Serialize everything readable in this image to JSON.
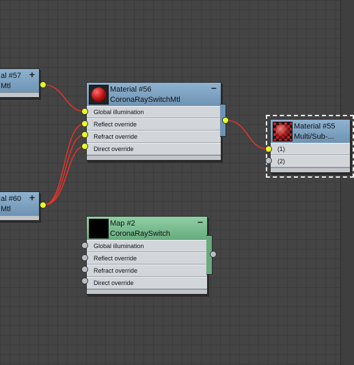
{
  "nodes": {
    "mat57": {
      "title": "al #57",
      "sub": "Mtl",
      "toggle": "+"
    },
    "mat60": {
      "title": "al #60",
      "sub": "Mtl",
      "toggle": "+"
    },
    "mat56": {
      "title": "Material #56",
      "sub": "CoronaRaySwitchMtl",
      "toggle": "−",
      "rows": [
        "Global illumination",
        "Reflect override",
        "Refract override",
        "Direct override"
      ]
    },
    "mat55": {
      "title": "Material #55",
      "sub": "Multi/Sub-...",
      "rows": [
        "(1)",
        "(2)"
      ]
    },
    "map2": {
      "title": "Map #2",
      "sub": "CoronaRaySwitch",
      "toggle": "−",
      "rows": [
        "Global illumination",
        "Reflect override",
        "Refract override",
        "Direct override"
      ]
    }
  },
  "colors": {
    "material_header": "#7fa3c2",
    "map_header": "#7bbd90",
    "wire": "#e8322a",
    "socket_connected": "#e6ff2a",
    "socket_empty": "#b9bec4"
  }
}
